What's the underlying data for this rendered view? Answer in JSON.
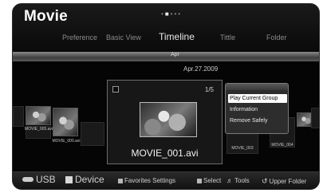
{
  "header": {
    "title": "Movie",
    "tabs": [
      {
        "label": "Preference",
        "active": false
      },
      {
        "label": "Basic View",
        "active": false
      },
      {
        "label": "Timeline",
        "active": true
      },
      {
        "label": "Tittle",
        "active": false
      },
      {
        "label": "Folder",
        "active": false
      }
    ],
    "page_dots_total": 5,
    "page_dots_active": 1
  },
  "timeline": {
    "label": "Apr",
    "date": "Apr.27.2009"
  },
  "thumbnails": [
    {
      "label": "MOVIE_005.avi"
    },
    {
      "label": "MOVIE_000.avi"
    },
    {
      "label": "MOVIE_003"
    },
    {
      "label": "MOVIE_004"
    }
  ],
  "selected": {
    "counter": "1/5",
    "filename": "MOVIE_001.avi"
  },
  "context_menu": {
    "items": [
      {
        "label": "Play Current Group",
        "selected": true
      },
      {
        "label": "Information",
        "selected": false
      },
      {
        "label": "Remove Safely",
        "selected": false
      }
    ]
  },
  "footer": {
    "usb": "USB",
    "device": "Device",
    "favorites": "Favorites Settings",
    "select": "Select",
    "tools": "Tools",
    "upper": "Upper Folder"
  },
  "colors": {
    "background": "#050505",
    "highlight": "#ffffff",
    "text": "#e6e6e6"
  }
}
